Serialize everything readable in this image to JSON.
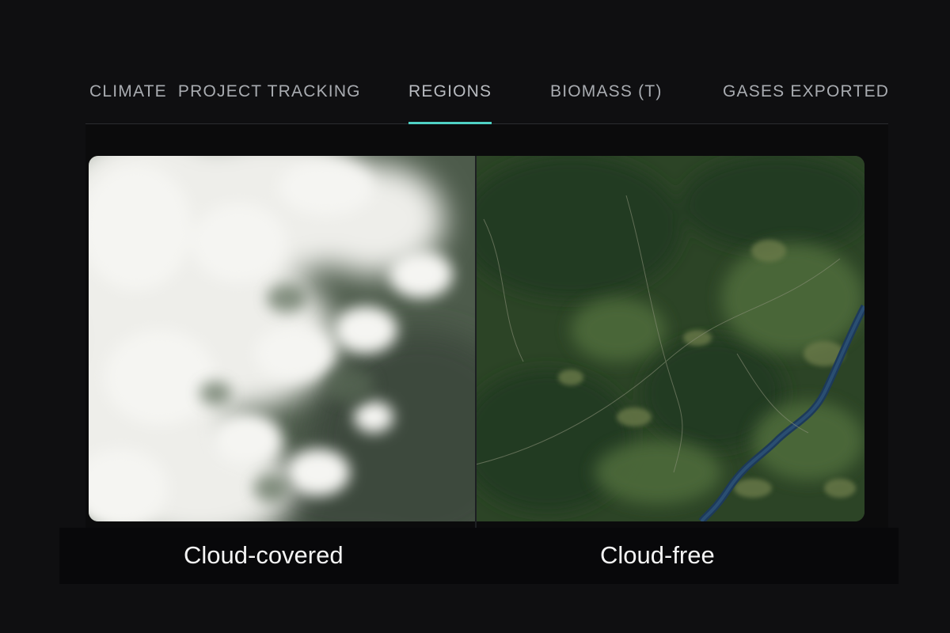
{
  "tabs": [
    {
      "label": "CLIMATE  PROJECT TRACKING",
      "active": false
    },
    {
      "label": "REGIONS",
      "active": true
    },
    {
      "label": "BIOMASS (T)",
      "active": false
    },
    {
      "label": "GASES EXPORTED",
      "active": false
    }
  ],
  "accent_color": "#4fd1c5",
  "comparison": {
    "left_caption": "Cloud-covered",
    "right_caption": "Cloud-free"
  }
}
